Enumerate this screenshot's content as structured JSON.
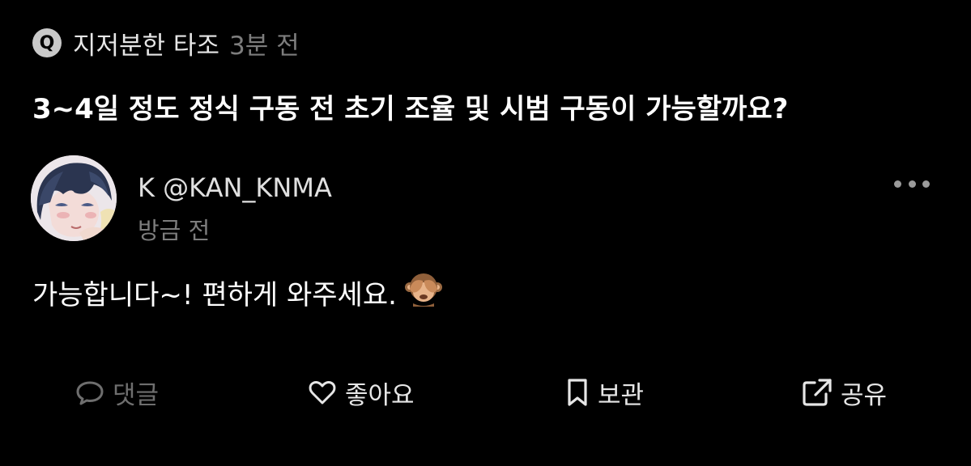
{
  "question": {
    "badge": "Q",
    "asker_name": "지저분한 타조",
    "time": "3분 전",
    "text": "3~4일 정도 정식 구동 전 초기 조율 및 시범 구동이 가능할까요?"
  },
  "answer": {
    "author_display": "K @KAN_KNMA",
    "time": "방금 전",
    "text": "가능합니다~! 편하게 와주세요.",
    "emoji": "see-no-evil-monkey",
    "more_icon": "more-horizontal-icon"
  },
  "actions": [
    {
      "label": "댓글",
      "icon": "comment-icon"
    },
    {
      "label": "좋아요",
      "icon": "heart-icon"
    },
    {
      "label": "보관",
      "icon": "bookmark-icon"
    },
    {
      "label": "공유",
      "icon": "share-icon"
    }
  ],
  "colors": {
    "background": "#000000",
    "primary_text": "#ffffff",
    "secondary_text": "#7d7d7d",
    "badge": "#c9c9c9"
  }
}
